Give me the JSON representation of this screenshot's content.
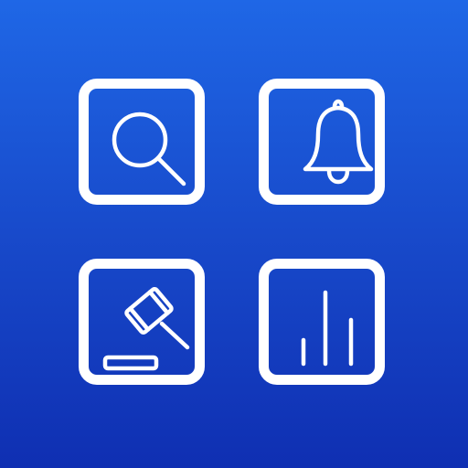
{
  "colors": {
    "background_top": "#1f67e6",
    "background_bottom": "#0f2fb2",
    "foreground": "#ffffff"
  },
  "tiles": [
    {
      "icon": "search-icon"
    },
    {
      "icon": "bell-icon"
    },
    {
      "icon": "gavel-icon"
    },
    {
      "icon": "bar-chart-icon"
    }
  ]
}
